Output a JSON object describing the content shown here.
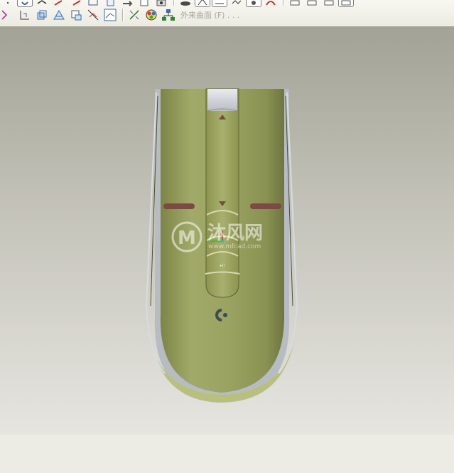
{
  "toolbar": {
    "top_row_tools": [
      "pointer-tool",
      "sketch-tool",
      "line-tool",
      "trim-tool",
      "offset-tool",
      "copy-tool",
      "rotate-tool",
      "datum-tool",
      "layer-tool",
      "paste-special-tool",
      "mirror-tool",
      "rotate-tool-2",
      "unknown-tool",
      "view-tool"
    ],
    "bottom_row_tools": [
      "pattern-tool",
      "dimension-tool",
      "extrude-tool",
      "revolve-tool",
      "sweep-tool",
      "blend-tool",
      "style-tool",
      "style-manager-tool",
      "appearance-tool",
      "model-tree-tool"
    ],
    "surface_label": "外来曲面 (F) . . ."
  },
  "viewport": {
    "background_top": "#a2a296",
    "background_bottom": "#e6e5e0",
    "model": {
      "name": "mouse-model",
      "body_color": "#9aa360",
      "accent_color": "#7a4a43",
      "logo_color": "#3d4a5a"
    },
    "watermark": {
      "main": "沐风网",
      "sub": "www.mfcad.com"
    },
    "button_labels": {
      "play_pause": "▸II"
    }
  },
  "colors": {
    "toolbar_bg": "#ecebe2",
    "status_bg": "#ecebe4"
  }
}
